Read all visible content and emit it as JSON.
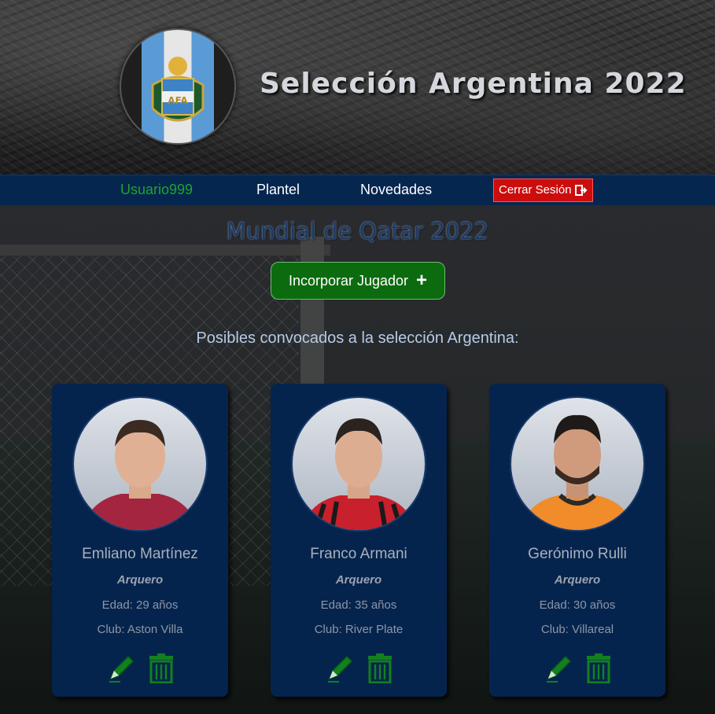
{
  "header": {
    "title": "Selección Argentina 2022",
    "logo_text": "AFA"
  },
  "nav": {
    "user": "Usuario999",
    "plantel": "Plantel",
    "novedades": "Novedades",
    "logout": "Cerrar Sesión",
    "logout_icon": "sign-out-icon"
  },
  "main": {
    "subtitle": "Mundial de Qatar 2022",
    "add_button": "Incorporar Jugador",
    "add_icon": "+",
    "section_label": "Posibles convocados a la selección Argentina:"
  },
  "players": [
    {
      "name": "Emliano Martínez",
      "role": "Arquero",
      "age": "Edad: 29 años",
      "club": "Club: Aston Villa",
      "shirt_color": "#a3253f"
    },
    {
      "name": "Franco Armani",
      "role": "Arquero",
      "age": "Edad: 35 años",
      "club": "Club: River Plate",
      "shirt_color": "#c8202c"
    },
    {
      "name": "Gerónimo Rulli",
      "role": "Arquero",
      "age": "Edad: 30 años",
      "club": "Club: Villareal",
      "shirt_color": "#f08c2a"
    }
  ],
  "colors": {
    "nav_bg": "#05264f",
    "user_green": "#1fa32d",
    "logout_red": "#cc0d0d",
    "add_green": "#0d6b0f",
    "card_bg": "#05244d",
    "icon_green": "#0f7a1a"
  }
}
